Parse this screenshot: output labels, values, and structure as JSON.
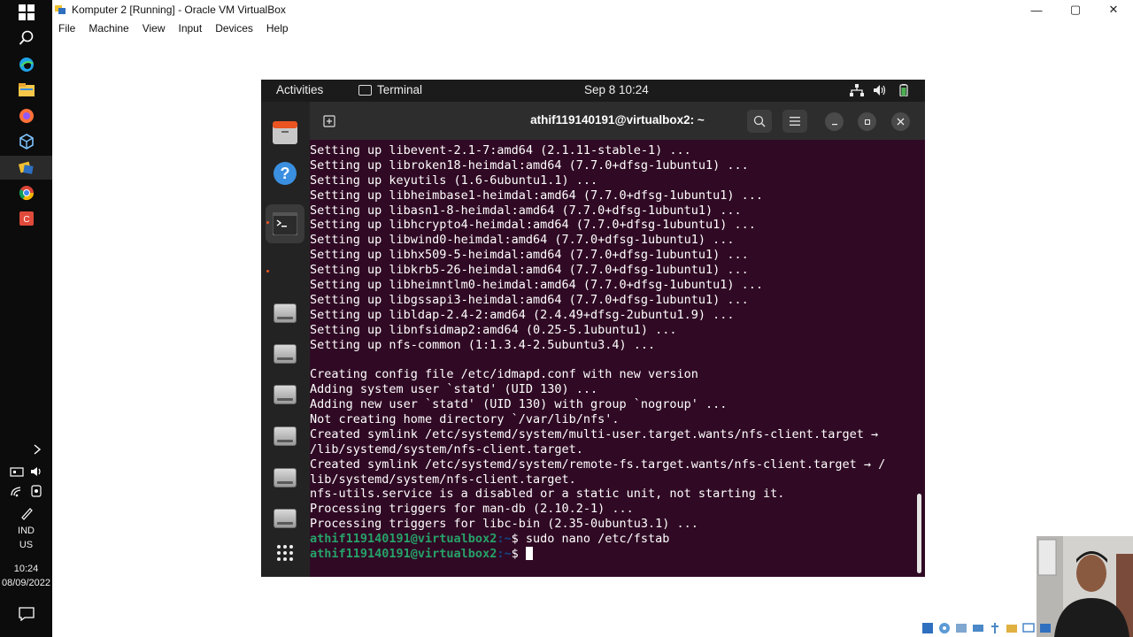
{
  "window": {
    "title": "Komputer 2 [Running] - Oracle VM VirtualBox",
    "menu": [
      "File",
      "Machine",
      "View",
      "Input",
      "Devices",
      "Help"
    ],
    "controls": {
      "minimize": "—",
      "maximize": "▢",
      "close": "✕"
    }
  },
  "windows_taskbar": {
    "language_line1": "IND",
    "language_line2": "US",
    "time": "10:24",
    "date": "08/09/2022"
  },
  "gnome": {
    "activities": "Activities",
    "app_name": "Terminal",
    "clock": "Sep 8  10:24"
  },
  "terminal": {
    "title": "athif119140191@virtualbox2: ~",
    "lines": [
      "Setting up libevent-2.1-7:amd64 (2.1.11-stable-1) ...",
      "Setting up libroken18-heimdal:amd64 (7.7.0+dfsg-1ubuntu1) ...",
      "Setting up keyutils (1.6-6ubuntu1.1) ...",
      "Setting up libheimbase1-heimdal:amd64 (7.7.0+dfsg-1ubuntu1) ...",
      "Setting up libasn1-8-heimdal:amd64 (7.7.0+dfsg-1ubuntu1) ...",
      "Setting up libhcrypto4-heimdal:amd64 (7.7.0+dfsg-1ubuntu1) ...",
      "Setting up libwind0-heimdal:amd64 (7.7.0+dfsg-1ubuntu1) ...",
      "Setting up libhx509-5-heimdal:amd64 (7.7.0+dfsg-1ubuntu1) ...",
      "Setting up libkrb5-26-heimdal:amd64 (7.7.0+dfsg-1ubuntu1) ...",
      "Setting up libheimntlm0-heimdal:amd64 (7.7.0+dfsg-1ubuntu1) ...",
      "Setting up libgssapi3-heimdal:amd64 (7.7.0+dfsg-1ubuntu1) ...",
      "Setting up libldap-2.4-2:amd64 (2.4.49+dfsg-2ubuntu1.9) ...",
      "Setting up libnfsidmap2:amd64 (0.25-5.1ubuntu1) ...",
      "Setting up nfs-common (1:1.3.4-2.5ubuntu3.4) ...",
      "",
      "Creating config file /etc/idmapd.conf with new version",
      "Adding system user `statd' (UID 130) ...",
      "Adding new user `statd' (UID 130) with group `nogroup' ...",
      "Not creating home directory `/var/lib/nfs'.",
      "Created symlink /etc/systemd/system/multi-user.target.wants/nfs-client.target →",
      "/lib/systemd/system/nfs-client.target.",
      "Created symlink /etc/systemd/system/remote-fs.target.wants/nfs-client.target → /",
      "lib/systemd/system/nfs-client.target.",
      "nfs-utils.service is a disabled or a static unit, not starting it.",
      "Processing triggers for man-db (2.10.2-1) ...",
      "Processing triggers for libc-bin (2.35-0ubuntu3.1) ..."
    ],
    "prompt_user": "athif119140191@virtualbox2",
    "prompt_path": ":~",
    "prompt_symbol": "$",
    "command_1": " sudo nano /etc/fstab",
    "command_2": " "
  },
  "colors": {
    "terminal_bg": "#300a24",
    "prompt_green": "#26a269",
    "prompt_blue": "#12488b",
    "ubuntu_orange": "#e95420"
  }
}
